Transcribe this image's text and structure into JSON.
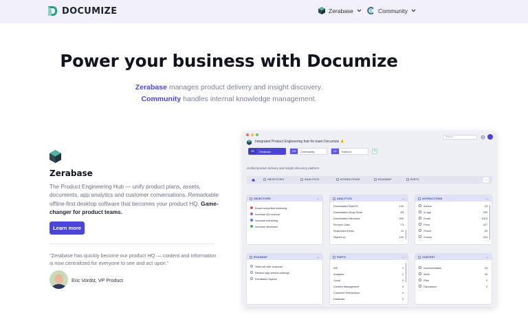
{
  "header": {
    "brand": "DOCUMIZE",
    "nav": [
      {
        "label": "Zerabase"
      },
      {
        "label": "Community"
      }
    ]
  },
  "hero": {
    "title": "Power your business with Documize",
    "line1_highlight": "Zerabase",
    "line1_rest": " manages product delivery and insight discovery.",
    "line2_highlight": "Community",
    "line2_rest": " handles internal knowledge management."
  },
  "product": {
    "title": "Zerabase",
    "description": "The Product Engineering Hub — unify product plans, assets, documents, app analytics and customer conversations. Remarkable offline-first desktop software that becomes your product HQ. ",
    "description_bold": "Game-changer for product teams.",
    "cta_label": "Learn more",
    "quote": "\"Zerabase has quickly become our product HQ — content and information is now centralized for everyone to see and act upon.\"",
    "author": "Eric Vordst, VP Product"
  },
  "app": {
    "window_title": "Integrated Product Engineering hub for team Documize 🤞",
    "search_placeholder": "Search...",
    "spaces": [
      {
        "code": "ZB",
        "name": "Zerabase"
      },
      {
        "code": "CM",
        "name": "Community"
      },
      {
        "code": "DC",
        "name": "Dotcom"
      }
    ],
    "add_label": "+",
    "description": "Unified product delivery and insight discovery platform",
    "tabs": [
      "OBJECTIVES",
      "ANALYTICS",
      "INTERACTIONS",
      "ROADMAP",
      "PARTS"
    ],
    "expand_label": "⌄",
    "cards": {
      "objectives": {
        "title": "OBJECTIVES",
        "items": [
          {
            "label": "Boost competitor switching",
            "color": "#e0524f"
          },
          {
            "label": "Increase Q3 revenue",
            "color": "#a05ad6"
          },
          {
            "label": "Increase marketing",
            "color": "#4a78e0"
          },
          {
            "label": "Increase stickiness",
            "color": "#3cb15a"
          }
        ]
      },
      "analytics": {
        "title": "ANALYTICS",
        "rows": [
          {
            "label": "Downloaded MacOS",
            "value": "142"
          },
          {
            "label": "Downloaded Snap Store",
            "value": "63"
          },
          {
            "label": "Downloaded Windows",
            "value": "309"
          },
          {
            "label": "Re-sync Data",
            "value": "73"
          },
          {
            "label": "Requested Demo",
            "value": "11"
          },
          {
            "label": "Signed up",
            "value": "144"
          }
        ]
      },
      "interactions": {
        "title": "INTERACTIONS",
        "rows": [
          {
            "label": "Ad-hoc",
            "value": "16"
          },
          {
            "label": "In-app",
            "value": "259"
          },
          {
            "label": "Email",
            "value": "1313"
          },
          {
            "label": "Form",
            "value": "427"
          },
          {
            "label": "Phone",
            "value": "69"
          },
          {
            "label": "Survey",
            "value": "116"
          }
        ]
      },
      "roadmap": {
        "title": "ROADMAP",
        "items": [
          "Start call with customer",
          "Restore app window settings",
          "Feedback Capture"
        ]
      },
      "parts": {
        "title": "PARTS",
        "rows": [
          {
            "label": "API",
            "value": "1"
          },
          {
            "label": "Analytics",
            "value": "2"
          },
          {
            "label": "Cloud",
            "value": "0"
          },
          {
            "label": "Content Management",
            "value": "0"
          },
          {
            "label": "Customer Interactions",
            "value": "4"
          },
          {
            "label": "Database",
            "value": "0"
          }
        ]
      },
      "content": {
        "title": "CONTENT",
        "rows": [
          {
            "label": "Documentation",
            "value": "25"
          },
          {
            "label": "Work",
            "value": "28"
          },
          {
            "label": "Files",
            "value": "0"
          },
          {
            "label": "Discussion",
            "value": "0"
          }
        ]
      }
    }
  },
  "colors": {
    "accent": "#4b45d4",
    "topbar_bg": "#f1f0fb",
    "card_head_bg": "#dfe2f6"
  }
}
